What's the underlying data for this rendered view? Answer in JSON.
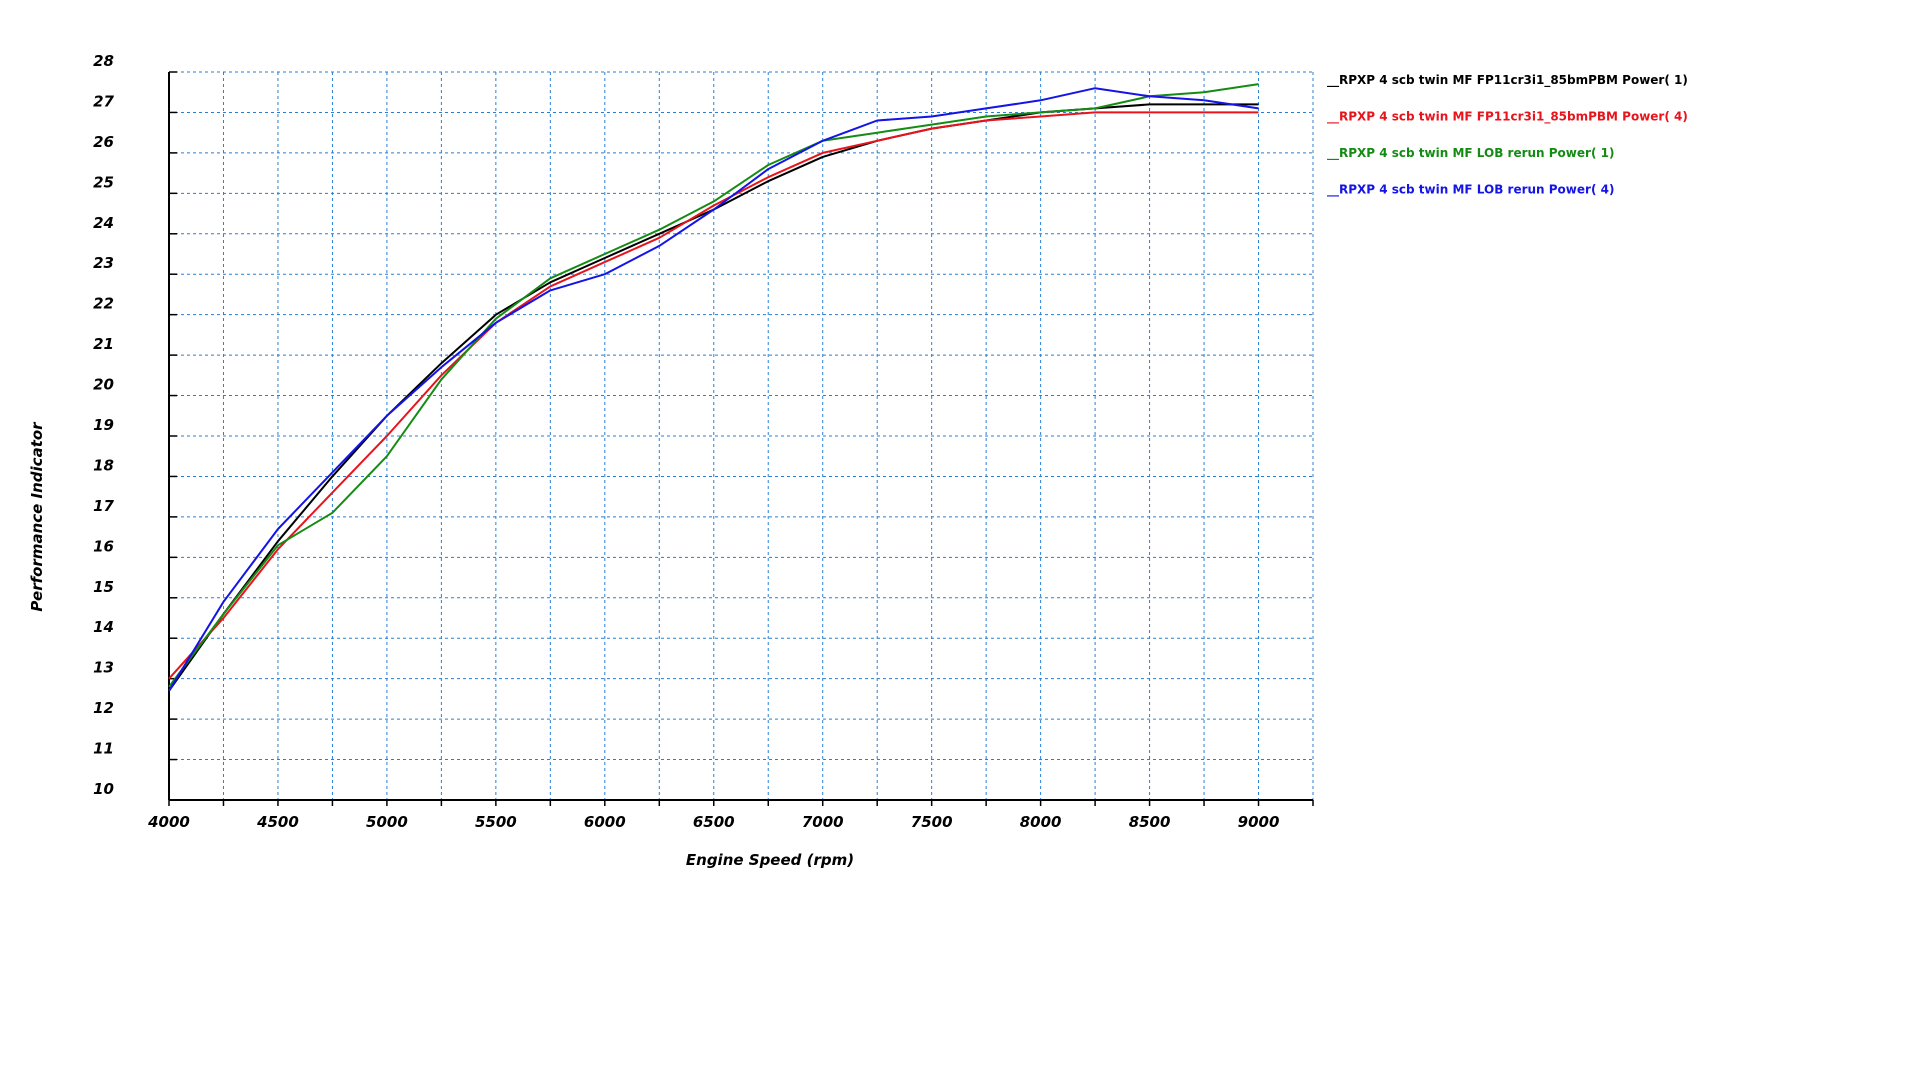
{
  "chart_data": {
    "type": "line",
    "xlabel": "Engine Speed (rpm)",
    "ylabel": "Performance Indicator",
    "xlim": [
      4000,
      9250
    ],
    "ylim": [
      10,
      28
    ],
    "x_ticks": [
      4000,
      4500,
      5000,
      5500,
      6000,
      6500,
      7000,
      7500,
      8000,
      8500,
      9000
    ],
    "y_ticks": [
      10,
      11,
      12,
      13,
      14,
      15,
      16,
      17,
      18,
      19,
      20,
      21,
      22,
      23,
      24,
      25,
      26,
      27,
      28
    ],
    "grid": true,
    "legend_position": "right",
    "series": [
      {
        "name": "__RPXP 4 scb twin MF FP11cr3i1_85bmPBM  Power( 1)",
        "color": "#000000",
        "x": [
          4000,
          4250,
          4500,
          4750,
          5000,
          5250,
          5500,
          5750,
          6000,
          6250,
          6500,
          6750,
          7000,
          7250,
          7500,
          7750,
          8000,
          8250,
          8500,
          8750,
          9000
        ],
        "y": [
          12.7,
          14.6,
          16.4,
          18.0,
          19.5,
          20.8,
          22.0,
          22.8,
          23.4,
          24.0,
          24.6,
          25.3,
          25.9,
          26.3,
          26.6,
          26.8,
          27.0,
          27.1,
          27.2,
          27.2,
          27.2
        ]
      },
      {
        "name": "__RPXP 4 scb twin MF FP11cr3i1_85bmPBM  Power( 4)",
        "color": "#e8141c",
        "x": [
          4000,
          4250,
          4500,
          4750,
          5000,
          5250,
          5500,
          5750,
          6000,
          6250,
          6500,
          6750,
          7000,
          7250,
          7500,
          7750,
          8000,
          8250,
          8500,
          8750,
          9000
        ],
        "y": [
          13.0,
          14.5,
          16.2,
          17.6,
          19.0,
          20.5,
          21.8,
          22.7,
          23.3,
          23.9,
          24.7,
          25.4,
          26.0,
          26.3,
          26.6,
          26.8,
          26.9,
          27.0,
          27.0,
          27.0,
          27.0
        ]
      },
      {
        "name": "__RPXP 4 scb twin MF LOB rerun  Power( 1)",
        "color": "#148c14",
        "x": [
          4000,
          4250,
          4500,
          4750,
          5000,
          5250,
          5500,
          5750,
          6000,
          6250,
          6500,
          6750,
          7000,
          7250,
          7500,
          7750,
          8000,
          8250,
          8500,
          8750,
          9000
        ],
        "y": [
          12.8,
          14.6,
          16.3,
          17.1,
          18.5,
          20.4,
          21.9,
          22.9,
          23.5,
          24.1,
          24.8,
          25.7,
          26.3,
          26.5,
          26.7,
          26.9,
          27.0,
          27.1,
          27.4,
          27.5,
          27.7
        ]
      },
      {
        "name": "__RPXP 4 scb twin MF LOB rerun  Power( 4)",
        "color": "#1414e6",
        "x": [
          4000,
          4250,
          4500,
          4750,
          5000,
          5250,
          5500,
          5750,
          6000,
          6250,
          6500,
          6750,
          7000,
          7250,
          7500,
          7750,
          8000,
          8250,
          8500,
          8750,
          9000
        ],
        "y": [
          12.7,
          14.9,
          16.7,
          18.1,
          19.5,
          20.7,
          21.8,
          22.6,
          23.0,
          23.7,
          24.6,
          25.6,
          26.3,
          26.8,
          26.9,
          27.1,
          27.3,
          27.6,
          27.4,
          27.3,
          27.1
        ]
      }
    ]
  }
}
